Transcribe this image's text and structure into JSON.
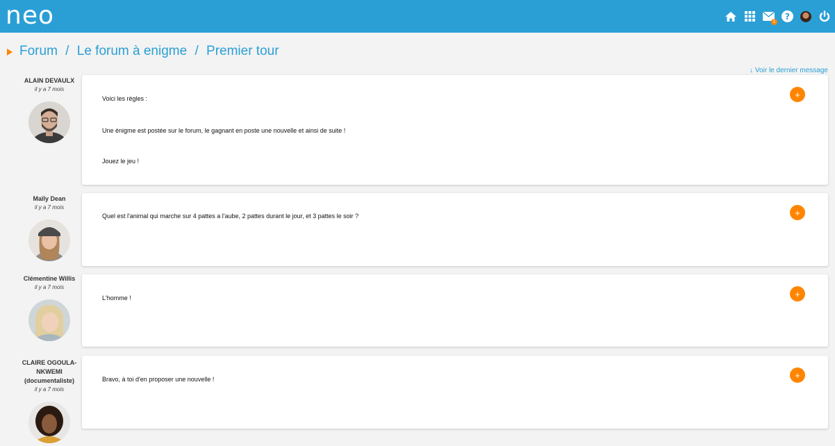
{
  "header": {
    "logo_text": "neo",
    "colors": {
      "bar": "#2a9fd6",
      "accent": "#ff8500"
    },
    "icons": [
      "home-icon",
      "apps-grid-icon",
      "messages-icon",
      "help-icon",
      "user-avatar-icon",
      "power-icon"
    ],
    "messages_badge": "1"
  },
  "breadcrumb": {
    "items": [
      "Forum",
      "Le forum à enigme",
      "Premier tour"
    ],
    "separator": " / "
  },
  "last_message_link": "↓ Voir le dernier message",
  "posts": [
    {
      "author": "ALAIN DEVAULX",
      "date": "il y a 7 mois",
      "paragraphs": [
        "Voici les règles :",
        "Une énigme est postée sur le forum, le gagnant en poste une nouvelle et ainsi de suite !",
        "Jouez le jeu !"
      ],
      "action_label": "+"
    },
    {
      "author": "Maïly Dean",
      "date": "il y a 7 mois",
      "paragraphs": [
        "Quel est l'animal qui marche sur 4 pattes a l'aube, 2 pattes durant le jour, et 3 pattes le soir ?"
      ],
      "action_label": "+"
    },
    {
      "author": "Clémentine Willis",
      "date": "il y a 7 mois",
      "paragraphs": [
        "L'homme !"
      ],
      "action_label": "+"
    },
    {
      "author": "CLAIRE OGOULA-NKWEMI (documentaliste)",
      "author_lines": [
        "CLAIRE OGOULA-",
        "NKWEMI",
        "(documentaliste)"
      ],
      "date": "il y a 7 mois",
      "paragraphs": [
        "Bravo, à toi d'en proposer une nouvelle !"
      ],
      "action_label": "+"
    }
  ]
}
